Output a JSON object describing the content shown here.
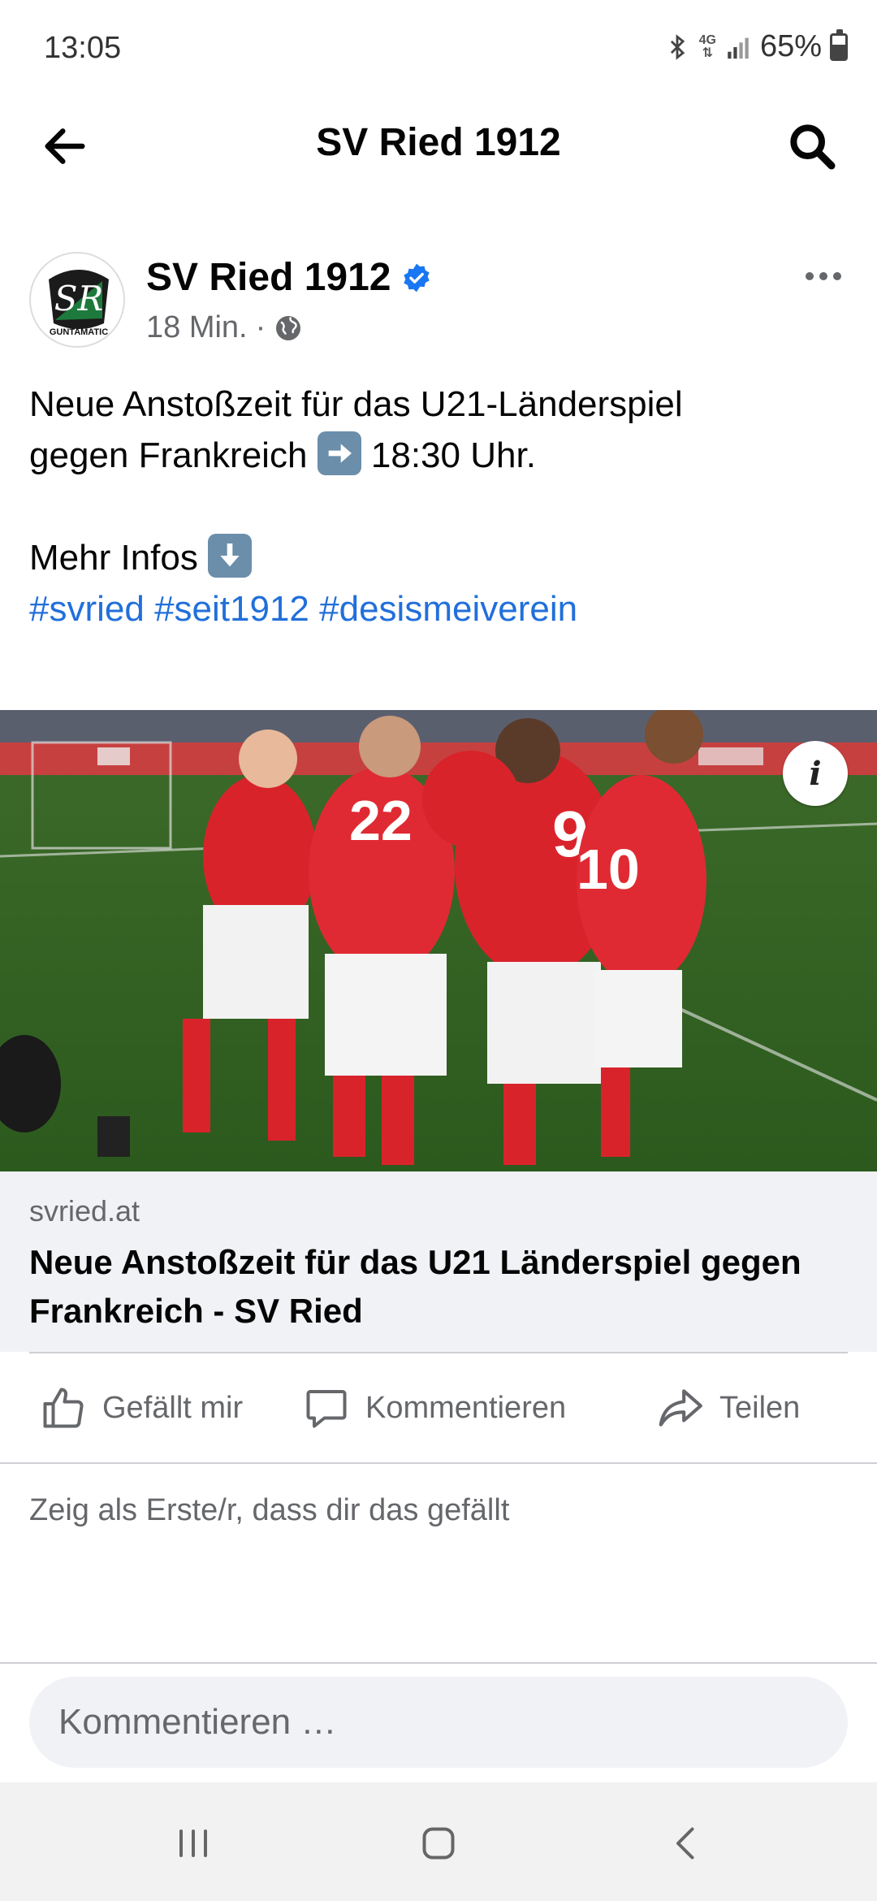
{
  "status_bar": {
    "time": "13:05",
    "network": "4G",
    "battery": "65%",
    "icons": [
      "bluetooth-icon",
      "network-4g-icon",
      "signal-icon",
      "battery-icon"
    ]
  },
  "header": {
    "title": "SV Ried 1912",
    "back_icon": "arrow-left-icon",
    "search_icon": "search-icon"
  },
  "post": {
    "page_name": "SV Ried 1912",
    "verified": true,
    "avatar_text": "GUNTAMATIC",
    "time_ago": "18 Min.",
    "separator": "·",
    "audience_icon": "globe-icon",
    "text_line1_a": "Neue Anstoßzeit für das U21-Länderspiel",
    "text_line2_a": "gegen Frankreich",
    "text_line2_b": "18:30 Uhr.",
    "text_more": "Mehr Infos",
    "hashtags": [
      "#svried",
      "#seit1912",
      "#desismeiverein"
    ],
    "image_alt": "Austrian U21 players in red jerseys celebrating on pitch",
    "info_label": "i"
  },
  "link_preview": {
    "domain": "svried.at",
    "title": "Neue Anstoßzeit für das U21 Länderspiel gegen Frankreich - SV Ried"
  },
  "actions": {
    "like": "Gefällt mir",
    "comment": "Kommentieren",
    "share": "Teilen"
  },
  "likes_prompt": "Zeig als Erste/r, dass dir das gefällt",
  "comment_box": {
    "placeholder": "Kommentieren …"
  },
  "colors": {
    "link_blue": "#216fdb",
    "verified_blue": "#1877f2",
    "secondary_text": "#65676b",
    "preview_bg": "#f0f2f5"
  }
}
